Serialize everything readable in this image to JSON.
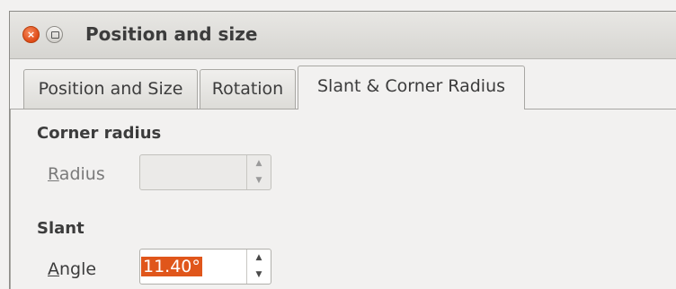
{
  "window": {
    "title": "Position and size"
  },
  "tabs": [
    {
      "label": "Position and Size",
      "active": false
    },
    {
      "label": "Rotation",
      "active": false
    },
    {
      "label": "Slant & Corner Radius",
      "active": true
    }
  ],
  "corner_radius": {
    "heading": "Corner radius",
    "radius_label_mnemonic": "R",
    "radius_label_rest": "adius",
    "radius_value": "",
    "enabled": false
  },
  "slant": {
    "heading": "Slant",
    "angle_label_mnemonic": "A",
    "angle_label_rest": "ngle",
    "angle_value": "11.40°",
    "value_selected": true
  },
  "icons": {
    "close": "close-icon",
    "minimize": "minimize-icon",
    "spin_up": "chevron-up-icon",
    "spin_down": "chevron-down-icon"
  },
  "colors": {
    "close_button": "#df4a16",
    "selection_highlight": "#e0561b",
    "window_background": "#f2f1f0"
  }
}
